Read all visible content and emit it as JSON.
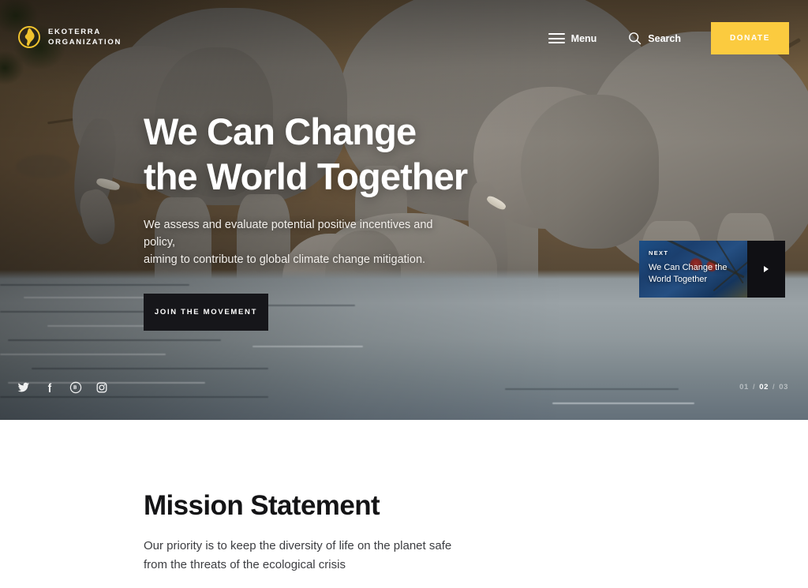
{
  "header": {
    "logo": {
      "icon": "globe-icon",
      "line1": "EKOTERRA",
      "line2": "ORGANIZATION"
    },
    "menu": {
      "icon": "hamburger-icon",
      "label": "Menu"
    },
    "search": {
      "icon": "search-icon",
      "label": "Search"
    },
    "donate": {
      "label": "Donate"
    }
  },
  "hero": {
    "title_line1": "We Can Change",
    "title_line2": "the World Together",
    "subtitle_line1": "We assess and evaluate potential positive incentives and policy,",
    "subtitle_line2": "aiming to contribute to global climate change mitigation.",
    "cta_label": "Join the Movement",
    "socials": [
      {
        "name": "twitter-icon",
        "label": "Twitter"
      },
      {
        "name": "facebook-icon",
        "label": "Facebook"
      },
      {
        "name": "behance-icon",
        "label": "Behance"
      },
      {
        "name": "instagram-icon",
        "label": "Instagram"
      }
    ],
    "slides": [
      {
        "number": "01",
        "active": false
      },
      {
        "number": "02",
        "active": true
      },
      {
        "number": "03",
        "active": false
      }
    ],
    "separator": "/",
    "next_card": {
      "label": "Next",
      "title_line1": "We Can Change the",
      "title_line2": "World Together",
      "arrow_icon": "play-arrow-icon"
    }
  },
  "mission": {
    "title": "Mission Statement",
    "text_line1": "Our priority is to keep the diversity of life on the planet safe",
    "text_line2": "from the threats of the ecological crisis"
  },
  "colors": {
    "accent_yellow": "#fbcb3f",
    "dark": "#16161a",
    "text_dark": "#141416",
    "text_body": "#3c3d41",
    "white": "#ffffff"
  }
}
